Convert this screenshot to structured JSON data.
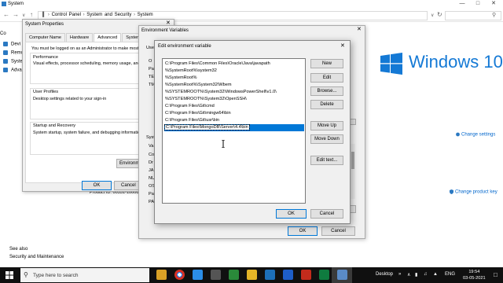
{
  "window": {
    "title": "System",
    "breadcrumb": [
      "Control Panel",
      "System and Security",
      "System"
    ],
    "left_nav": [
      "Devi",
      "Remo",
      "Syste",
      "Adva"
    ],
    "see_also": "See also",
    "security_link": "Security and Maintenance",
    "change_settings": "Change settings",
    "change_product_key": "Change product key",
    "product_id": "Product ID: 00331-10000",
    "windows_brand": "Windows 10"
  },
  "sysprops": {
    "title": "System Properties",
    "tabs": [
      "Computer Name",
      "Hardware",
      "Advanced",
      "System Protection"
    ],
    "admin_note": "You must be logged on as an Administrator to make most of",
    "performance_title": "Performance",
    "performance_desc": "Visual effects, processor scheduling, memory usage, and vir",
    "user_profiles_title": "User Profiles",
    "user_profiles_desc": "Desktop settings related to your sign-in",
    "startup_title": "Startup and Recovery",
    "startup_desc": "System startup, system failure, and debugging information",
    "env_button": "Environment",
    "ok": "OK",
    "cancel": "Cancel"
  },
  "envvars": {
    "title": "Environment Variables",
    "user_label": "User",
    "user_rows": [
      "O",
      "Pa",
      "TE",
      "TM"
    ],
    "system_label": "Syst",
    "system_rows": [
      "Va",
      "Co",
      "Dr",
      "JA",
      "NU",
      "OS",
      "Pa",
      "PA"
    ],
    "ok": "OK",
    "cancel": "Cancel"
  },
  "edit": {
    "title": "Edit environment variable",
    "paths": [
      "C:\\Program Files\\Common Files\\Oracle\\Java\\javapath",
      "%SystemRoot%\\system32",
      "%SystemRoot%",
      "%SystemRoot%\\System32\\Wbem",
      "%SYSTEMROOT%\\System32\\WindowsPowerShell\\v1.0\\",
      "%SYSTEMROOT%\\System32\\OpenSSH\\",
      "C:\\Program Files\\Git\\cmd",
      "C:\\Program Files\\Git\\mingw64\\bin",
      "C:\\Program Files\\Git\\usr\\bin",
      "C:\\Program Files\\MongoDB\\Server\\4.4\\bin"
    ],
    "selected_index": 9,
    "buttons": {
      "new": "New",
      "edit": "Edit",
      "browse": "Browse...",
      "delete": "Delete",
      "move_up": "Move Up",
      "move_down": "Move Down",
      "edit_text": "Edit text..."
    },
    "ok": "OK",
    "cancel": "Cancel"
  },
  "taskbar": {
    "search_placeholder": "Type here to search",
    "desktop_label": "Desktop",
    "language": "ENG",
    "time": "19:54",
    "date": "03-05-2021"
  },
  "colors": {
    "accent": "#0078d7",
    "windows_blue": "#1479d5",
    "taskbar": "#101010"
  }
}
